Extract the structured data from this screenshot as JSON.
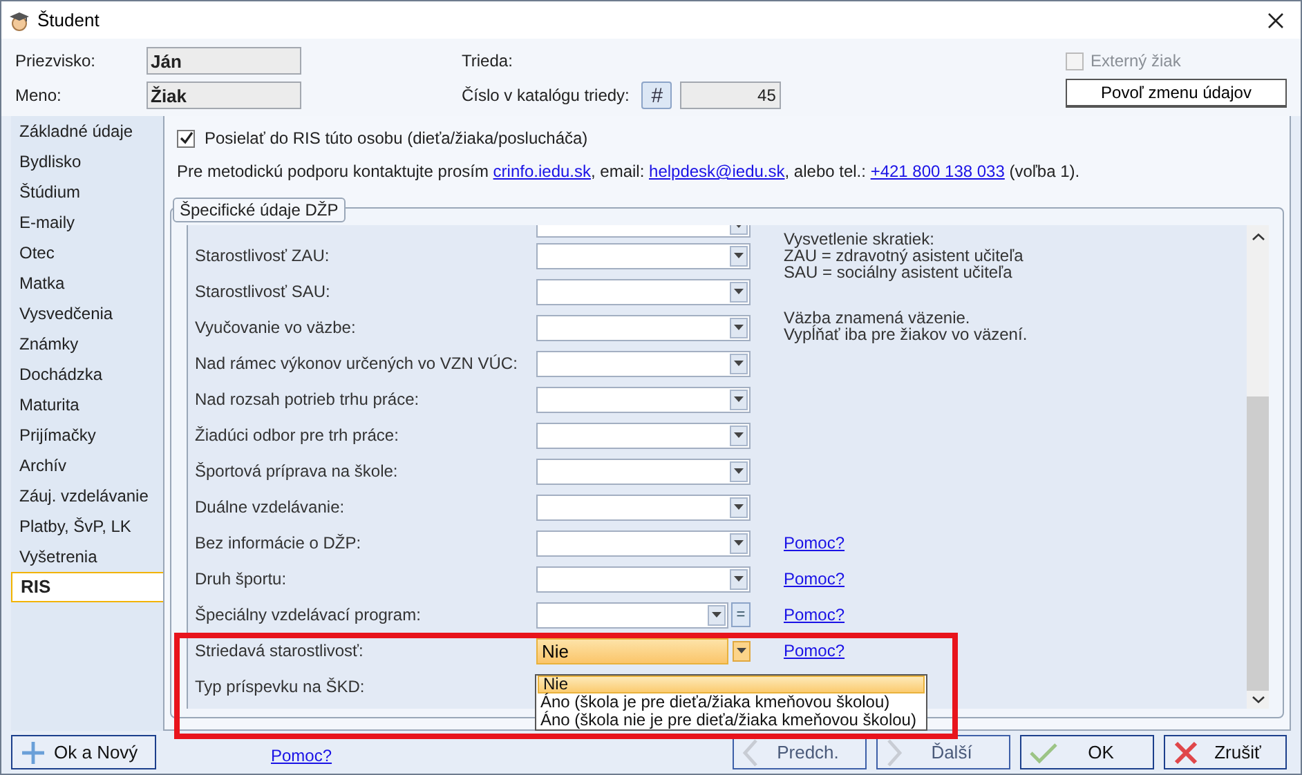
{
  "window": {
    "title": "Študent"
  },
  "header": {
    "surname": {
      "label": "Priezvisko:",
      "value": "Ján"
    },
    "name": {
      "label": "Meno:",
      "value": "Žiak"
    },
    "class": {
      "label": "Trieda:"
    },
    "catalog": {
      "label": "Číslo v katalógu triedy:",
      "button": "#",
      "value": "45"
    },
    "external": {
      "label": "Externý žiak",
      "checked": false,
      "disabled": true
    },
    "unlock_button": "Povoľ zmenu údajov"
  },
  "sidebar": {
    "items": [
      {
        "label": "Základné údaje",
        "selected": false
      },
      {
        "label": "Bydlisko",
        "selected": false
      },
      {
        "label": "Štúdium",
        "selected": false
      },
      {
        "label": "E-maily",
        "selected": false
      },
      {
        "label": "Otec",
        "selected": false
      },
      {
        "label": "Matka",
        "selected": false
      },
      {
        "label": "Vysvedčenia",
        "selected": false
      },
      {
        "label": "Známky",
        "selected": false
      },
      {
        "label": "Dochádzka",
        "selected": false
      },
      {
        "label": "Maturita",
        "selected": false
      },
      {
        "label": "Prijímačky",
        "selected": false
      },
      {
        "label": "Archív",
        "selected": false
      },
      {
        "label": "Záuj. vzdelávanie",
        "selected": false
      },
      {
        "label": "Platby, ŠvP, LK",
        "selected": false
      },
      {
        "label": "Vyšetrenia",
        "selected": false
      },
      {
        "label": "RIS",
        "selected": true
      }
    ]
  },
  "ris": {
    "send": {
      "label": "Posielať do RIS túto osobu (dieťa/žiaka/poslucháča)",
      "checked": true
    },
    "contact": [
      {
        "kind": "text",
        "text": "Pre metodickú podporu kontaktujte prosím "
      },
      {
        "kind": "link",
        "text": "crinfo.iedu.sk"
      },
      {
        "kind": "text",
        "text": ", email: "
      },
      {
        "kind": "link",
        "text": "helpdesk@iedu.sk"
      },
      {
        "kind": "text",
        "text": ", alebo tel.: "
      },
      {
        "kind": "link",
        "text": "+421 800 138 033"
      },
      {
        "kind": "text",
        "text": " (voľba 1)."
      }
    ],
    "group": {
      "title": "Špecifické údaje DŽP",
      "fields": [
        {
          "kind": "combo"
        },
        {
          "kind": "combo",
          "label": "Starostlivosť ZAU:"
        },
        {
          "kind": "combo",
          "label": "Starostlivosť SAU:"
        },
        {
          "kind": "combo",
          "label": "Vyučovanie vo väzbe:"
        },
        {
          "kind": "combo",
          "label": "Nad rámec výkonov určených vo VZN VÚC:"
        },
        {
          "kind": "combo",
          "label": "Nad rozsah potrieb trhu práce:"
        },
        {
          "kind": "combo",
          "label": "Žiadúci odbor pre trh práce:"
        },
        {
          "kind": "combo",
          "label": "Športová príprava na škole:"
        },
        {
          "kind": "combo",
          "label": "Duálne vzdelávanie:"
        },
        {
          "kind": "combo",
          "label": "Bez informácie o DŽP:",
          "help": "Pomoc?"
        },
        {
          "kind": "combo",
          "label": "Druh športu:",
          "help": "Pomoc?"
        },
        {
          "kind": "combo-button",
          "label": "Špeciálny vzdelávací program:",
          "button": "=",
          "help": "Pomoc?"
        },
        {
          "kind": "open-combo",
          "label": "Striedavá starostlivosť:",
          "value": "Nie",
          "help": "Pomoc?",
          "options": [
            {
              "label": "Nie",
              "selected": true
            },
            {
              "label": "Áno (škola je pre dieťa/žiaka kmeňovou školou)",
              "selected": false
            },
            {
              "label": "Áno (škola nie je pre dieťa/žiaka kmeňovou školou)",
              "selected": false
            }
          ]
        },
        {
          "kind": "covered",
          "label": "Typ príspevku na ŠKD:"
        }
      ],
      "notes": [
        {
          "lines": [
            "Vysvetlenie skratiek:",
            "ZAU = zdravotný asistent učiteľa",
            "SAU = sociálny asistent učiteľa"
          ]
        },
        {
          "lines": [
            "Väzba znamená väzenie.",
            "Vypĺňať iba pre žiakov vo väzení."
          ]
        }
      ]
    }
  },
  "footer": {
    "ok_new": "Ok a Nový",
    "help": "Pomoc?",
    "buttons": [
      {
        "kind": "prev",
        "label": "Predch."
      },
      {
        "kind": "next",
        "label": "Ďalší"
      },
      {
        "kind": "ok",
        "label": "OK"
      },
      {
        "kind": "cancel",
        "label": "Zrušiť"
      }
    ]
  }
}
